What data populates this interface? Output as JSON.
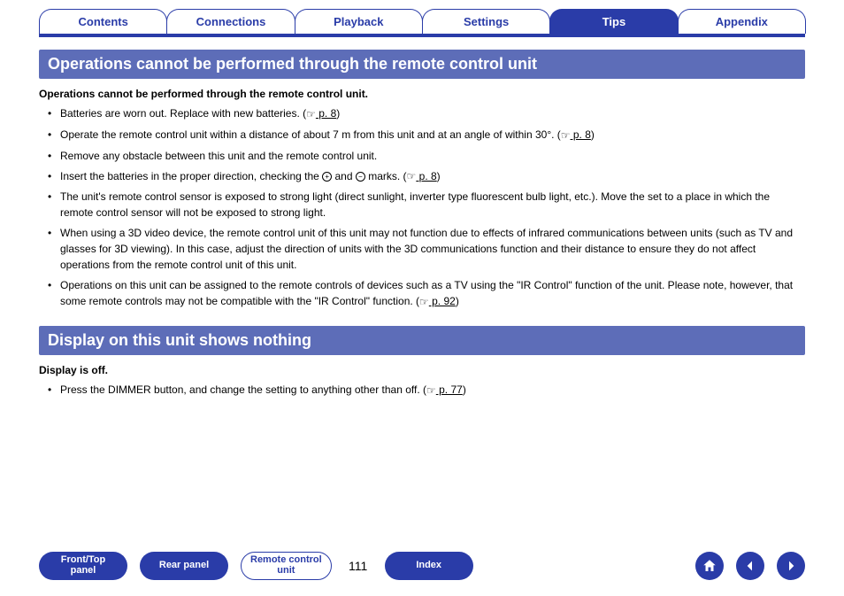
{
  "tabs": {
    "contents": "Contents",
    "connections": "Connections",
    "playback": "Playback",
    "settings": "Settings",
    "tips": "Tips",
    "appendix": "Appendix",
    "active": "tips"
  },
  "section1": {
    "title": "Operations cannot be performed through the remote control unit",
    "subhead": "Operations cannot be performed through the remote control unit.",
    "items": [
      {
        "text_before": "Batteries are worn out. Replace with new batteries.  (",
        "link": " p. 8",
        "text_after": ")"
      },
      {
        "text_before": "Operate the remote control unit within a distance of about 7 m from this unit and at an angle of within 30°.  (",
        "link": " p. 8",
        "text_after": ")"
      },
      {
        "text_before": "Remove any obstacle between this unit and the remote control unit."
      },
      {
        "text_before": "Insert the batteries in the proper direction, checking the ",
        "plus": "+",
        "mid": " and ",
        "minus": "−",
        "after_marks": " marks.  (",
        "link": " p. 8",
        "text_after": ")"
      },
      {
        "text_before": "The unit's remote control sensor is exposed to strong light (direct sunlight, inverter type fluorescent bulb light, etc.). Move the set to a place in which the remote control sensor will not be exposed to strong light."
      },
      {
        "text_before": "When using a 3D video device, the remote control unit of this unit may not function due to effects of infrared communications between units (such as TV and glasses for 3D viewing). In this case, adjust the direction of units with the 3D communications function and their distance to ensure they do not affect operations from the remote control unit of this unit."
      },
      {
        "text_before": "Operations on this unit can be assigned to the remote controls of devices such as a TV using the \"IR Control\" function of the unit. Please note, however, that some remote controls may not be compatible with the \"IR Control\" function.  (",
        "link": " p. 92",
        "text_after": ")"
      }
    ]
  },
  "section2": {
    "title": "Display on this unit shows nothing",
    "subhead": "Display is off.",
    "items": [
      {
        "text_before": "Press the DIMMER button, and change the setting to anything other than off.  (",
        "link": " p. 77",
        "text_after": ")"
      }
    ]
  },
  "bottom": {
    "front_top": "Front/Top\npanel",
    "rear": "Rear panel",
    "remote": "Remote control\nunit",
    "page": "111",
    "index": "Index"
  }
}
